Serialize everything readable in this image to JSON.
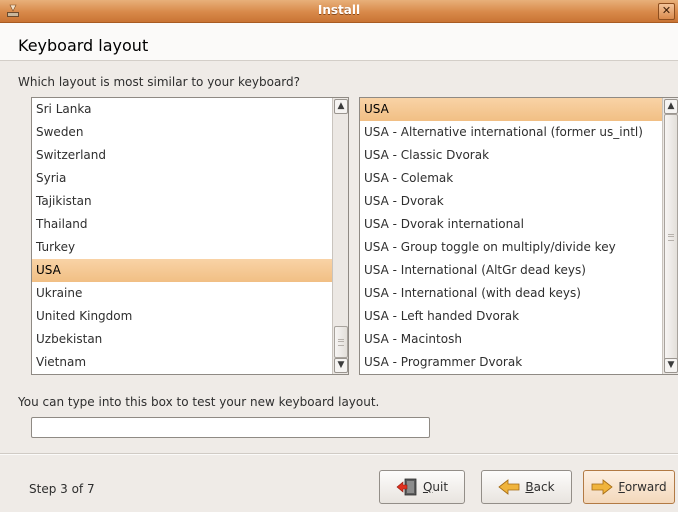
{
  "window": {
    "title": "Install"
  },
  "header": {
    "title": "Keyboard layout"
  },
  "question": "Which layout is most similar to your keyboard?",
  "countries": {
    "items": [
      "Sri Lanka",
      "Sweden",
      "Switzerland",
      "Syria",
      "Tajikistan",
      "Thailand",
      "Turkey",
      "USA",
      "Ukraine",
      "United Kingdom",
      "Uzbekistan",
      "Vietnam"
    ],
    "selected_index": 7
  },
  "variants": {
    "items": [
      "USA",
      "USA - Alternative international (former us_intl)",
      "USA - Classic Dvorak",
      "USA - Colemak",
      "USA - Dvorak",
      "USA - Dvorak international",
      "USA - Group toggle on multiply/divide key",
      "USA - International (AltGr dead keys)",
      "USA - International (with dead keys)",
      "USA - Left handed Dvorak",
      "USA - Macintosh",
      "USA - Programmer Dvorak"
    ],
    "selected_index": 0
  },
  "test": {
    "label": "You can type into this box to test your new keyboard layout.",
    "value": ""
  },
  "footer": {
    "step": "Step 3 of 7",
    "quit": {
      "mnemonic": "Q",
      "rest": "uit"
    },
    "back": {
      "mnemonic": "B",
      "rest": "ack"
    },
    "forward": {
      "mnemonic": "F",
      "rest": "orward"
    }
  },
  "colors": {
    "accent": "#f1bf84",
    "titlebar": "#d8894a"
  },
  "icons": {
    "app": "installer-icon",
    "quit": "quit-icon",
    "back": "back-arrow-icon",
    "forward": "forward-arrow-icon"
  }
}
